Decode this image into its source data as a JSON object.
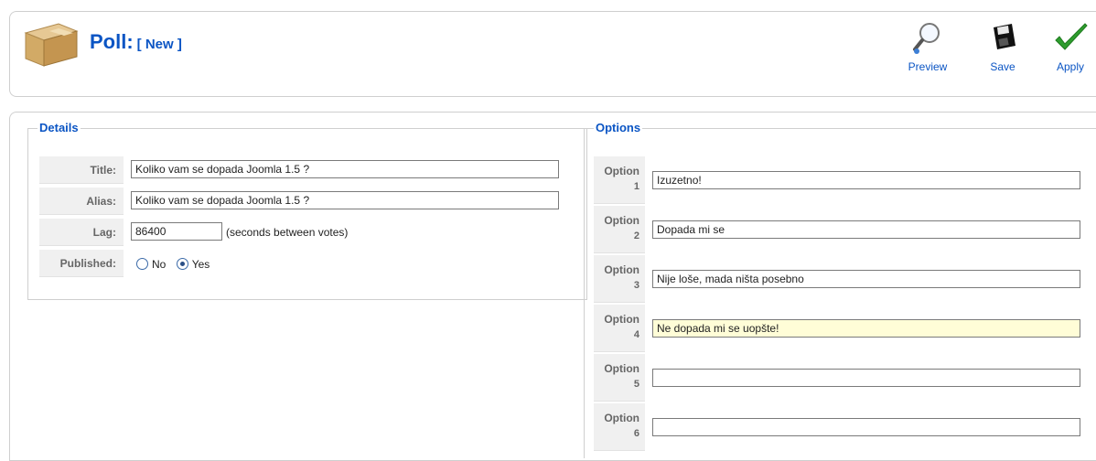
{
  "header": {
    "title": "Poll:",
    "subtitle": "[ New ]"
  },
  "toolbar": {
    "preview_label": "Preview",
    "save_label": "Save",
    "apply_label": "Apply"
  },
  "details": {
    "legend": "Details",
    "title_label": "Title:",
    "title_value": "Koliko vam se dopada Joomla 1.5 ?",
    "alias_label": "Alias:",
    "alias_value": "Koliko vam se dopada Joomla 1.5 ?",
    "lag_label": "Lag:",
    "lag_value": "86400",
    "lag_hint": "(seconds between votes)",
    "published_label": "Published:",
    "published_no": "No",
    "published_yes": "Yes",
    "published_selected": "Yes"
  },
  "options": {
    "legend": "Options",
    "items": [
      {
        "label": "Option",
        "num": "1",
        "value": "Izuzetno!"
      },
      {
        "label": "Option",
        "num": "2",
        "value": "Dopada mi se"
      },
      {
        "label": "Option",
        "num": "3",
        "value": "Nije loše, mada ništa posebno"
      },
      {
        "label": "Option",
        "num": "4",
        "value": "Ne dopada mi se uopšte!"
      },
      {
        "label": "Option",
        "num": "5",
        "value": ""
      },
      {
        "label": "Option",
        "num": "6",
        "value": ""
      }
    ]
  },
  "colors": {
    "accent": "#0b55c4",
    "highlight_field": "#fffdd7",
    "apply_check": "#2e9d2e"
  },
  "icons": [
    "package-box-icon",
    "magnifier-icon",
    "floppy-disk-icon",
    "checkmark-icon"
  ]
}
